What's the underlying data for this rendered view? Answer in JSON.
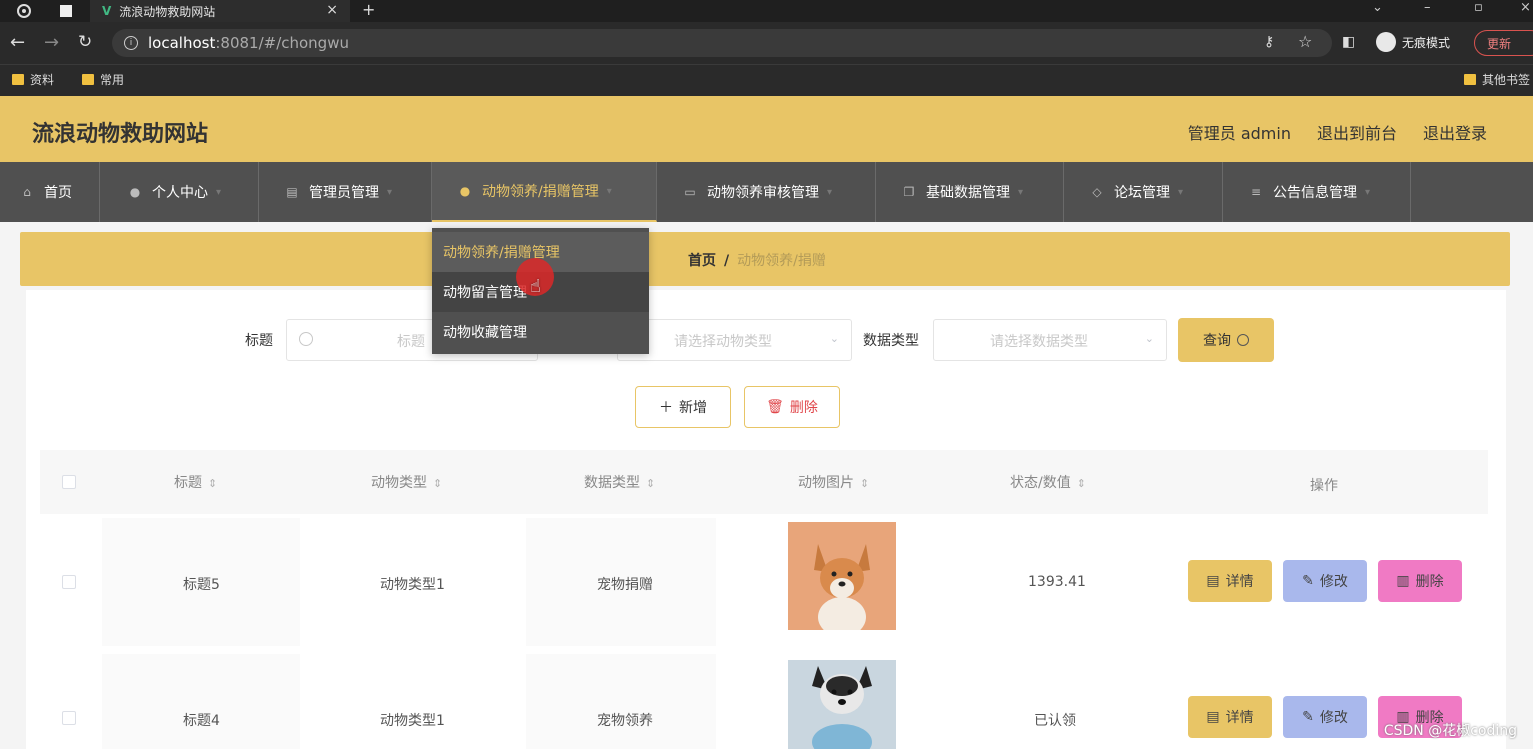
{
  "browser": {
    "tab_title": "流浪动物救助网站",
    "url_host": "localhost",
    "url_path": ":8081/#/chongwu",
    "incognito_label": "无痕模式",
    "update_label": "更新",
    "bookmarks": [
      "资料",
      "常用",
      "其他书签"
    ]
  },
  "header": {
    "site_title": "流浪动物救助网站",
    "admin_label": "管理员 admin",
    "back_front": "退出到前台",
    "logout": "退出登录"
  },
  "nav": {
    "items": [
      {
        "label": "首页"
      },
      {
        "label": "个人中心"
      },
      {
        "label": "管理员管理"
      },
      {
        "label": "动物领养/捐赠管理"
      },
      {
        "label": "动物领养审核管理"
      },
      {
        "label": "基础数据管理"
      },
      {
        "label": "论坛管理"
      },
      {
        "label": "公告信息管理"
      }
    ],
    "active_index": 3
  },
  "dropdown": {
    "items": [
      "动物领养/捐赠管理",
      "动物留言管理",
      "动物收藏管理"
    ]
  },
  "breadcrumb": {
    "home": "首页",
    "separator": "/",
    "current": "动物领养/捐赠"
  },
  "search": {
    "title_label": "标题",
    "title_placeholder": "标题",
    "animal_type_placeholder": "请选择动物类型",
    "data_type_label": "数据类型",
    "data_type_placeholder": "请选择数据类型",
    "query_label": "查询"
  },
  "actions": {
    "add_label": "新增",
    "delete_label": "删除"
  },
  "table": {
    "columns": [
      "标题",
      "动物类型",
      "数据类型",
      "动物图片",
      "状态/数值",
      "操作"
    ],
    "rows": [
      {
        "title": "标题5",
        "animal_type": "动物类型1",
        "data_type": "宠物捐赠",
        "status": "1393.41"
      },
      {
        "title": "标题4",
        "animal_type": "动物类型1",
        "data_type": "宠物领养",
        "status": "已认领"
      }
    ],
    "op_detail": "详情",
    "op_edit": "修改",
    "op_delete": "删除"
  },
  "watermark": "CSDN @花椒coding",
  "colors": {
    "accent": "#e8c566",
    "nav_bg": "#505050",
    "edit": "#a9b8ec",
    "delete": "#f07ac4"
  }
}
